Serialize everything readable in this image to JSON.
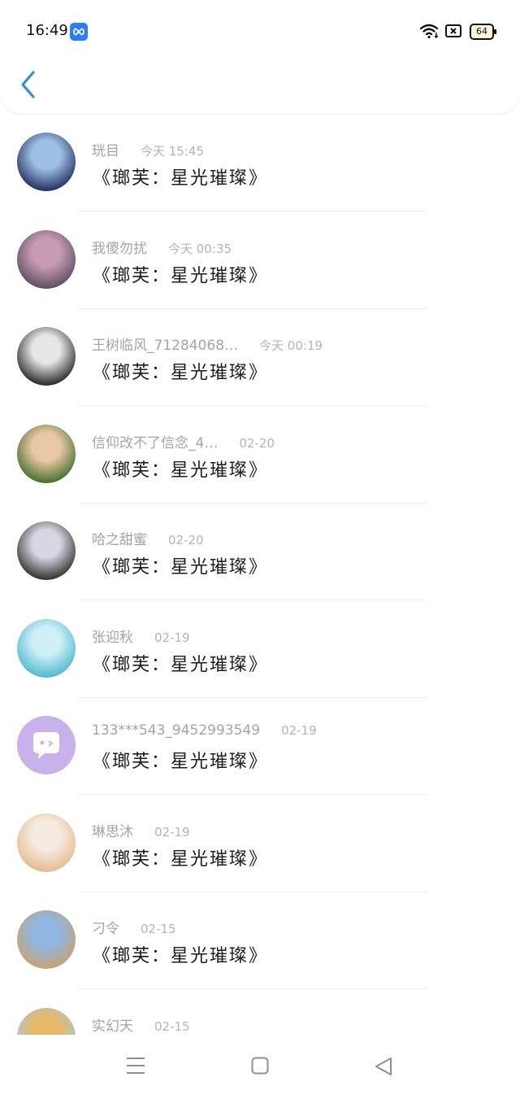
{
  "status": {
    "time": "16:49",
    "battery": "64"
  },
  "comments": [
    {
      "name": "珖目",
      "time": "今天 15:45",
      "title": "《瑯芙：星光璀璨》",
      "avatar_colors": [
        "#1c2a5a",
        "#9fc0e6"
      ]
    },
    {
      "name": "我傻勿扰",
      "time": "今天 00:35",
      "title": "《瑯芙：星光璀璨》",
      "avatar_colors": [
        "#5b4a5c",
        "#c79bb2"
      ]
    },
    {
      "name": "王树临风_71284068…",
      "time": "今天 00:19",
      "title": "《瑯芙：星光璀璨》",
      "avatar_colors": [
        "#1e1e1e",
        "#e6e6e6"
      ]
    },
    {
      "name": "信仰改不了信念_4…",
      "time": "02-20",
      "title": "《瑯芙：星光璀璨》",
      "avatar_colors": [
        "#3f6a2a",
        "#e8c8a4"
      ]
    },
    {
      "name": "哈之甜蜜",
      "time": "02-20",
      "title": "《瑯芙：星光璀璨》",
      "avatar_colors": [
        "#2a2a2a",
        "#d6d6e2"
      ]
    },
    {
      "name": "张迎秋",
      "time": "02-19",
      "title": "《瑯芙：星光璀璨》",
      "avatar_colors": [
        "#4ab6cc",
        "#cdeff6"
      ]
    },
    {
      "name": "133***543_9452993549",
      "time": "02-19",
      "title": "《瑯芙：星光璀璨》",
      "avatar_colors": [
        "#c7b2ec",
        "#ffffff"
      ]
    },
    {
      "name": "琳思沐",
      "time": "02-19",
      "title": "《瑯芙：星光璀璨》",
      "avatar_colors": [
        "#e2b98c",
        "#f6ebe0"
      ]
    },
    {
      "name": "刁令",
      "time": "02-15",
      "title": "《瑯芙：星光璀璨》",
      "avatar_colors": [
        "#caa270",
        "#8fb6e0"
      ]
    },
    {
      "name": "实幻天",
      "time": "02-15",
      "title": "",
      "avatar_colors": [
        "#9ec9e8",
        "#e6b86a"
      ]
    }
  ],
  "icons": {
    "back": "chevron-left-icon",
    "app": "infinity-icon",
    "wifi": "wifi-icon",
    "signal": "no-sim-icon",
    "nav_menu": "menu-icon",
    "nav_home": "home-icon",
    "nav_back": "back-triangle-icon"
  }
}
